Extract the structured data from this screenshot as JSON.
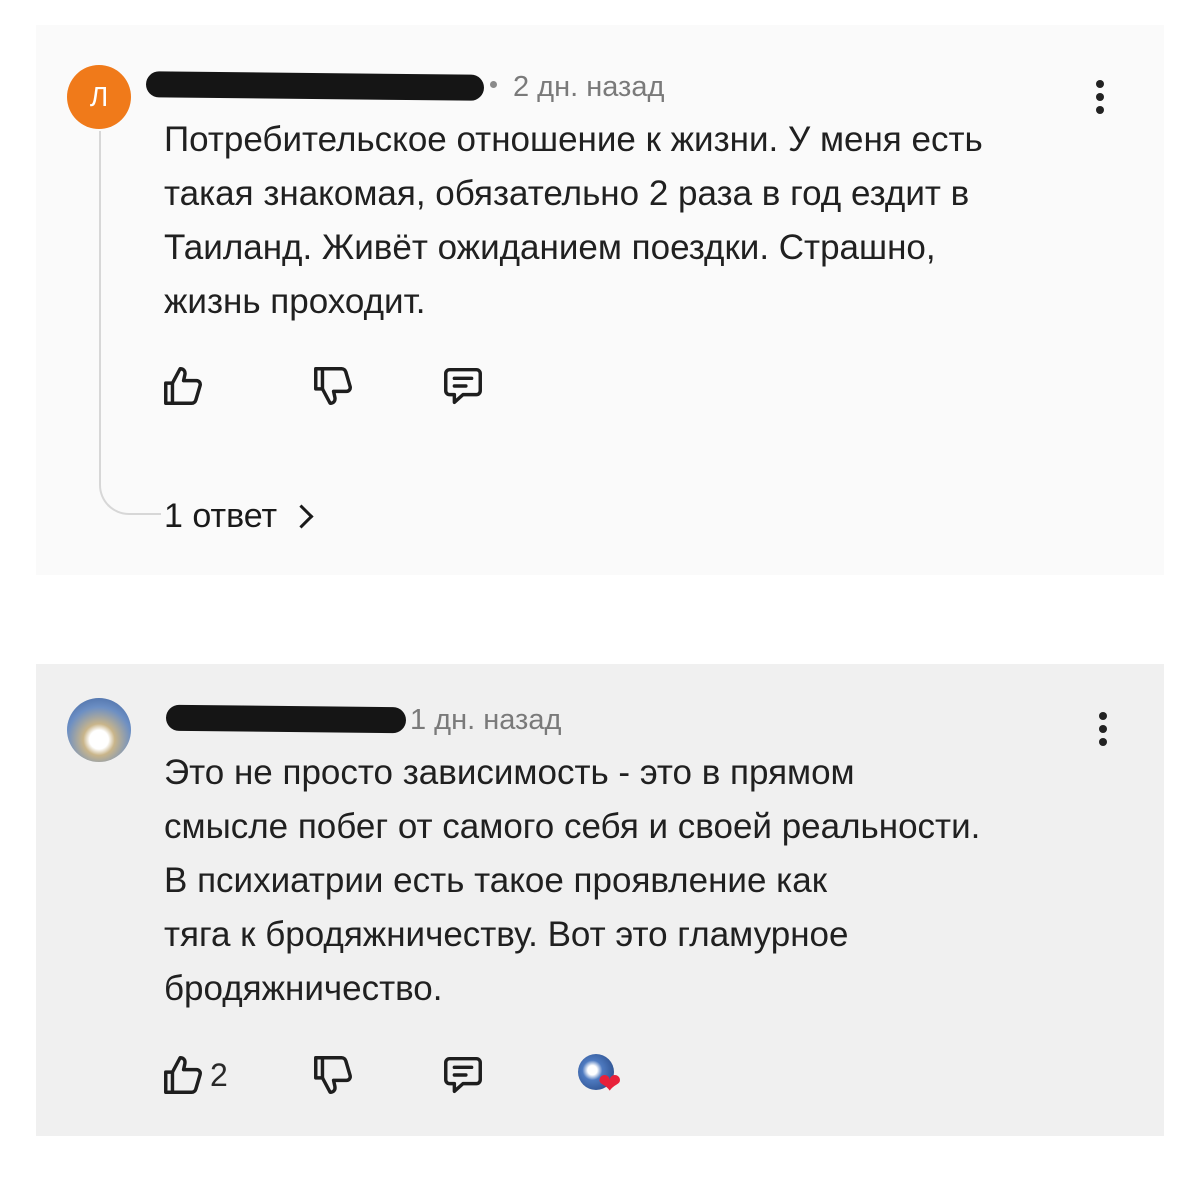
{
  "comments": [
    {
      "avatar_letter": "Л",
      "avatar_color": "#f07a1a",
      "time": "2 дн. назад",
      "text_lines": [
        "Потребительское отношение к жизни. У меня есть",
        "такая знакомая, обязательно 2 раза в год ездит в",
        "Таиланд. Живёт ожиданием поездки. Страшно,",
        "жизнь проходит."
      ],
      "likes": "",
      "replies_label": "1 ответ"
    },
    {
      "avatar_letter": "",
      "time": "1 дн. назад",
      "text_lines": [
        "Это не просто зависимость - это в прямом",
        "смысле побег от самого себя и своей реальности.",
        "В психиатрии есть  такое проявление как",
        "тяга к бродяжничеству. Вот это гламурное",
        "бродяжничество."
      ],
      "likes": "2"
    }
  ],
  "icons": [
    "thumbs-up-icon",
    "thumbs-down-icon",
    "reply-icon",
    "more-vertical-icon",
    "chevron-right-icon",
    "author-heart-icon"
  ]
}
